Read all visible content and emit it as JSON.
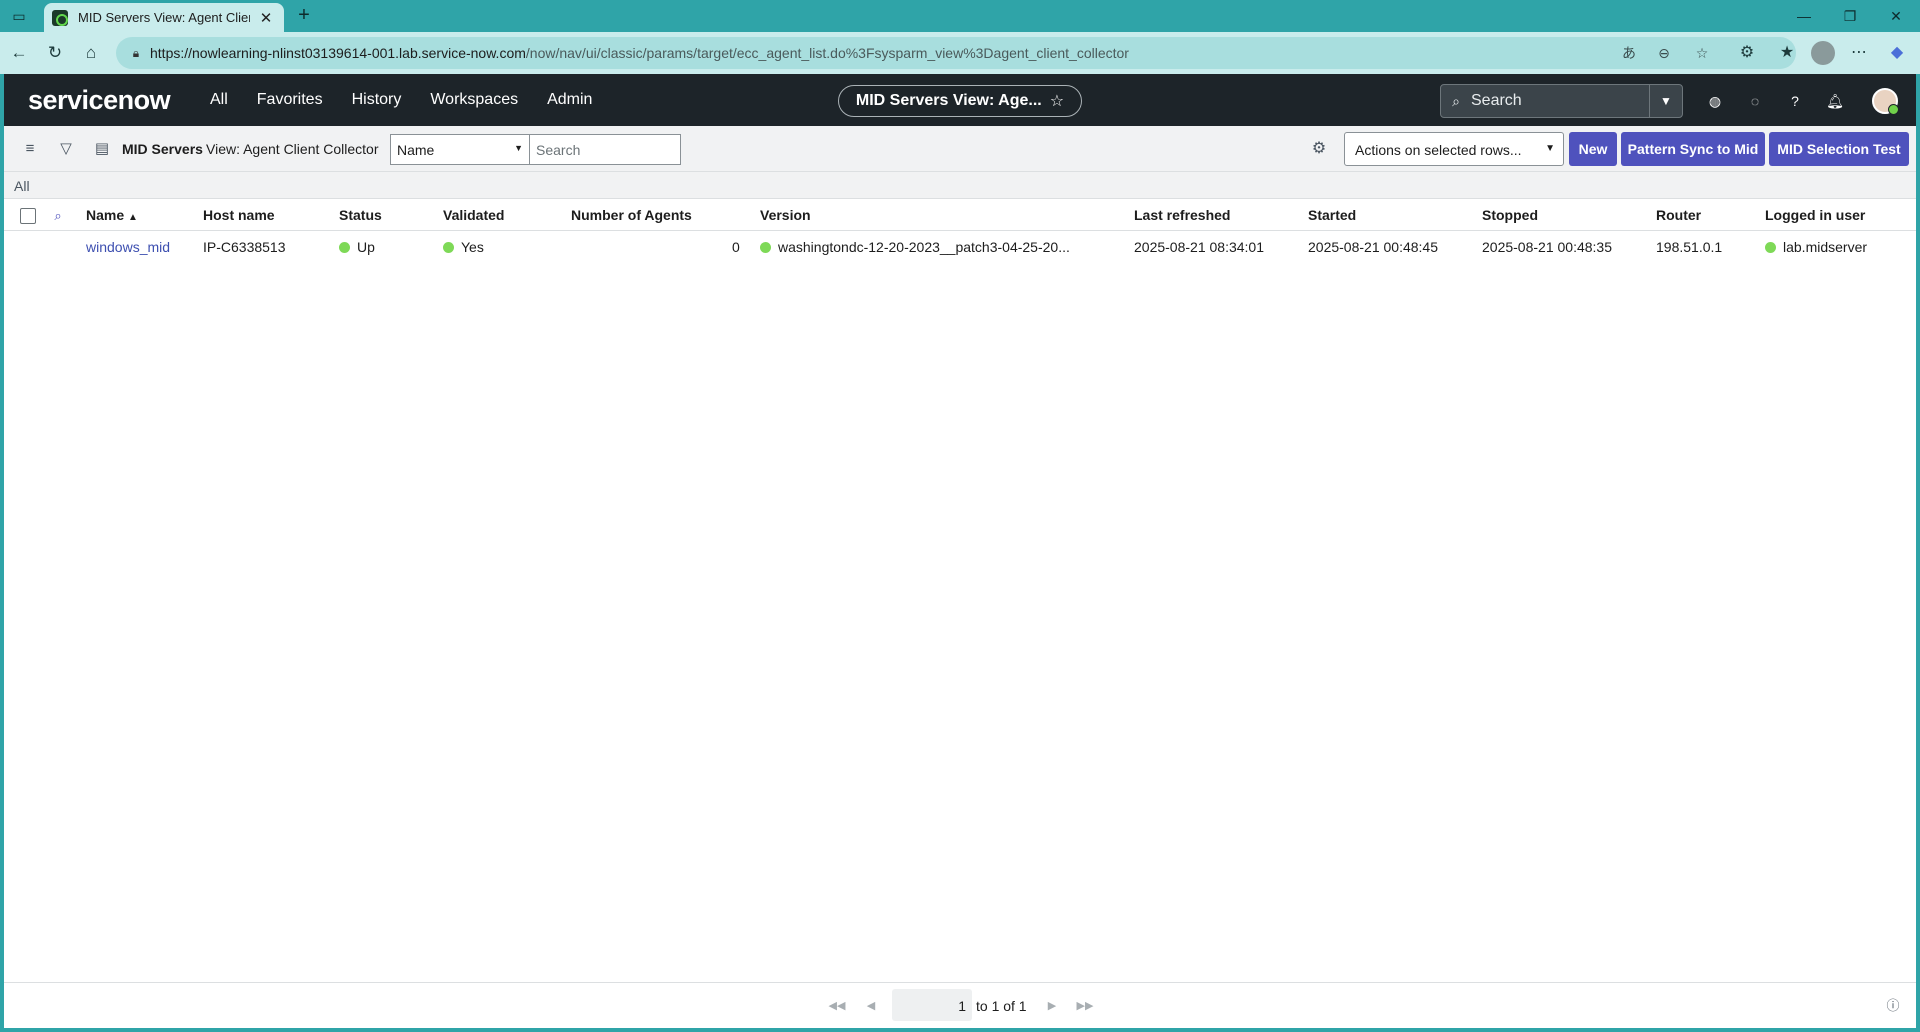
{
  "browser": {
    "tab_title": "MID Servers View: Agent Client C",
    "url_host": "https://nowlearning-nlinst03139614-001.lab.service-now.com",
    "url_path": "/now/nav/ui/classic/params/target/ecc_agent_list.do%3Fsysparm_view%3Dagent_client_collector"
  },
  "header": {
    "logo": "servicenow",
    "nav": [
      "All",
      "Favorites",
      "History",
      "Workspaces",
      "Admin"
    ],
    "context_pill": "MID Servers View: Age...",
    "search_placeholder": "Search"
  },
  "toolbar": {
    "title": "MID Servers",
    "view": "View: Agent Client Collector",
    "field_select": "Name",
    "search_placeholder": "Search",
    "actions_select": "Actions on selected rows...",
    "buttons": {
      "new": "New",
      "pattern_sync": "Pattern Sync to Mid",
      "mid_selection": "MID Selection Test"
    }
  },
  "breadcrumb": "All",
  "table": {
    "columns": {
      "name": "Name",
      "host": "Host name",
      "status": "Status",
      "validated": "Validated",
      "agents": "Number of Agents",
      "version": "Version",
      "last_refreshed": "Last refreshed",
      "started": "Started",
      "stopped": "Stopped",
      "router": "Router",
      "logged_user": "Logged in user"
    },
    "rows": [
      {
        "name": "windows_mid",
        "host": "IP-C6338513",
        "status": "Up",
        "validated": "Yes",
        "agents": "0",
        "version": "washingtondc-12-20-2023__patch3-04-25-20...",
        "last_refreshed": "2025-08-21 08:34:01",
        "started": "2025-08-21 00:48:45",
        "stopped": "2025-08-21 00:48:35",
        "router": "198.51.0.1",
        "logged_user": "lab.midserver"
      }
    ]
  },
  "pagination": {
    "page": "1",
    "summary": "to 1 of 1"
  },
  "colors": {
    "accent": "#4f52bd",
    "header_bg": "#1d2429",
    "status_green": "#7ed957"
  }
}
